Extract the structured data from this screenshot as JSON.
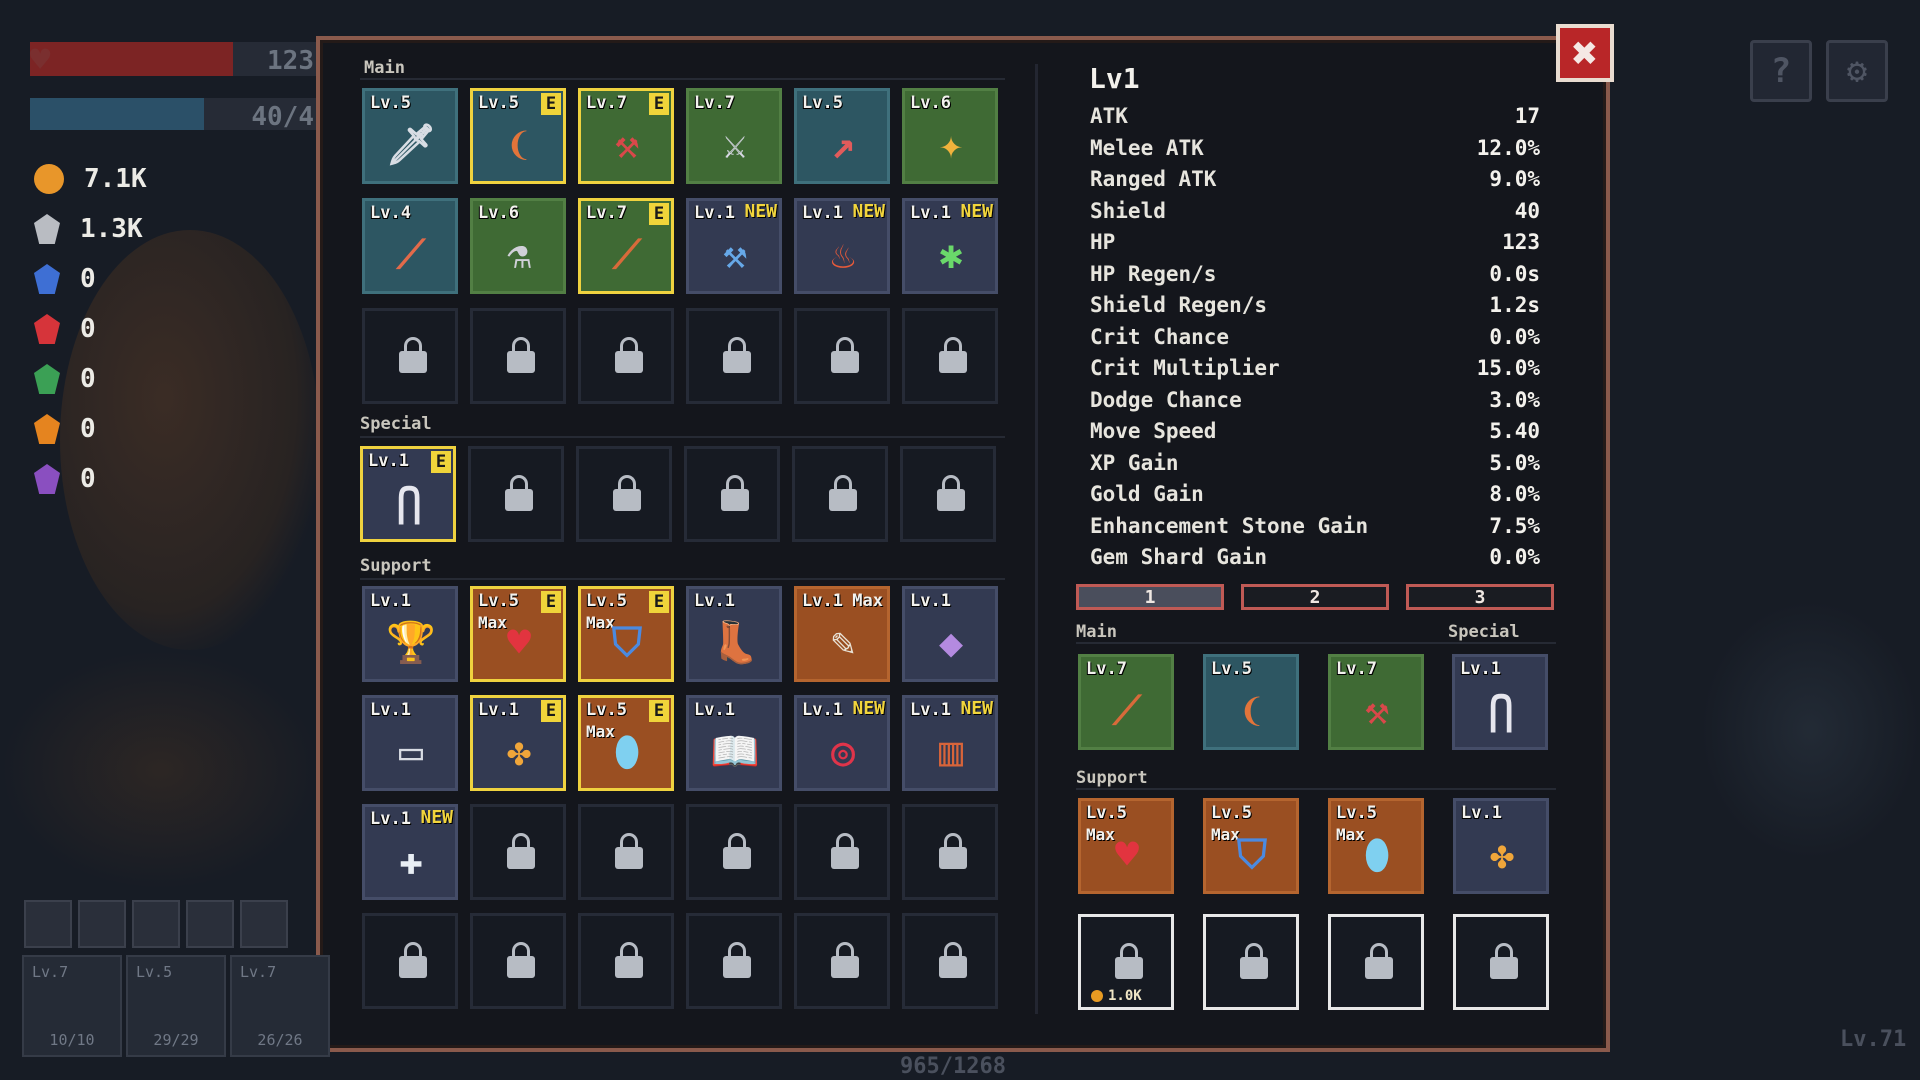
{
  "hud": {
    "hp_text": "123",
    "xp_text": "40/4",
    "hp_fraction": 0.7,
    "xp_fraction": 0.6,
    "resources": [
      {
        "icon": "gold-coin-icon",
        "color": "#e8962a",
        "value": "7.1K"
      },
      {
        "icon": "silver-stone-icon",
        "color": "#b9bcc2",
        "value": "1.3K"
      },
      {
        "icon": "blue-gem-icon",
        "color": "#3e6fd4",
        "value": "0"
      },
      {
        "icon": "red-gem-icon",
        "color": "#d6343a",
        "value": "0"
      },
      {
        "icon": "green-gem-icon",
        "color": "#3ba055",
        "value": "0"
      },
      {
        "icon": "orange-gem-icon",
        "color": "#e5841f",
        "value": "0"
      },
      {
        "icon": "purple-gem-icon",
        "color": "#8a4fc0",
        "value": "0"
      }
    ],
    "help_label": "?",
    "exp_counter": "965/1268",
    "player_level": "Lv.71",
    "weapons": [
      {
        "level": "Lv.7",
        "count": "10/10"
      },
      {
        "level": "Lv.5",
        "count": "29/29"
      },
      {
        "level": "Lv.7",
        "count": "26/26"
      }
    ]
  },
  "close_label": "✖",
  "sections": {
    "main": "Main",
    "special": "Special",
    "support": "Support"
  },
  "inventory": {
    "main": [
      {
        "level": "Lv.5",
        "color": "teal",
        "icon": "sword-icon",
        "glyph": "🗡",
        "equipped": false,
        "badge": ""
      },
      {
        "level": "Lv.5",
        "color": "teal",
        "icon": "boomerang-icon",
        "glyph": "❨",
        "equipped": true,
        "badge": "E"
      },
      {
        "level": "Lv.7",
        "color": "green",
        "icon": "axe-icon",
        "glyph": "⚒",
        "equipped": true,
        "badge": "E"
      },
      {
        "level": "Lv.7",
        "color": "green",
        "icon": "gauntlet-sword-icon",
        "glyph": "⚔",
        "equipped": false,
        "badge": ""
      },
      {
        "level": "Lv.5",
        "color": "teal",
        "icon": "spear-icon",
        "glyph": "↗",
        "equipped": false,
        "badge": ""
      },
      {
        "level": "Lv.6",
        "color": "green",
        "icon": "magic-staff-icon",
        "glyph": "✦",
        "equipped": false,
        "badge": ""
      },
      {
        "level": "Lv.4",
        "color": "teal",
        "icon": "dagger-icon",
        "glyph": "⟋",
        "equipped": false,
        "badge": ""
      },
      {
        "level": "Lv.6",
        "color": "green",
        "icon": "potion-flask-icon",
        "glyph": "⚗",
        "equipped": false,
        "badge": ""
      },
      {
        "level": "Lv.7",
        "color": "green",
        "icon": "wand-icon",
        "glyph": "⟋",
        "equipped": true,
        "badge": "E"
      },
      {
        "level": "Lv.1",
        "color": "blue",
        "icon": "hammer-icon",
        "glyph": "⚒",
        "equipped": false,
        "badge": "NEW"
      },
      {
        "level": "Lv.1",
        "color": "blue",
        "icon": "torch-icon",
        "glyph": "♨",
        "equipped": false,
        "badge": "NEW"
      },
      {
        "level": "Lv.1",
        "color": "blue",
        "icon": "trident-icon",
        "glyph": "✱",
        "equipped": false,
        "badge": "NEW"
      },
      {
        "locked": true
      },
      {
        "locked": true
      },
      {
        "locked": true
      },
      {
        "locked": true
      },
      {
        "locked": true
      },
      {
        "locked": true
      }
    ],
    "special": [
      {
        "level": "Lv.1",
        "color": "blue",
        "icon": "arch-gate-icon",
        "glyph": "⋂",
        "equipped": true,
        "badge": "E"
      },
      {
        "locked": true
      },
      {
        "locked": true
      },
      {
        "locked": true
      },
      {
        "locked": true
      },
      {
        "locked": true
      }
    ],
    "support": [
      {
        "level": "Lv.1",
        "color": "blue",
        "icon": "trophy-icon",
        "glyph": "🏆",
        "equipped": false,
        "badge": ""
      },
      {
        "level": "Lv.5",
        "max": "Max",
        "color": "orange",
        "icon": "heart-icon",
        "glyph": "♥",
        "equipped": true,
        "badge": "E"
      },
      {
        "level": "Lv.5",
        "max": "Max",
        "color": "orange",
        "icon": "shield-icon",
        "glyph": "⛉",
        "equipped": true,
        "badge": "E"
      },
      {
        "level": "Lv.1",
        "color": "blue",
        "icon": "boot-icon",
        "glyph": "👢",
        "equipped": false,
        "badge": ""
      },
      {
        "level": "Lv.1",
        "maxright": "Max",
        "color": "orange",
        "icon": "feather-icon",
        "glyph": "✎",
        "equipped": false,
        "badge": ""
      },
      {
        "level": "Lv.1",
        "color": "blue",
        "icon": "crystal-orb-icon",
        "glyph": "◆",
        "equipped": false,
        "badge": ""
      },
      {
        "level": "Lv.1",
        "color": "blue",
        "icon": "scroll-icon",
        "glyph": "▭",
        "equipped": false,
        "badge": ""
      },
      {
        "level": "Lv.1",
        "color": "blue",
        "icon": "clover-icon",
        "glyph": "✤",
        "equipped": true,
        "badge": "E"
      },
      {
        "level": "Lv.5",
        "max": "Max",
        "color": "orange",
        "icon": "crystal-shard-icon",
        "glyph": "⬮",
        "equipped": true,
        "badge": "E"
      },
      {
        "level": "Lv.1",
        "color": "blue",
        "icon": "book-icon",
        "glyph": "📖",
        "equipped": false,
        "badge": ""
      },
      {
        "level": "Lv.1",
        "color": "blue",
        "icon": "ring-icon",
        "glyph": "◎",
        "equipped": false,
        "badge": "NEW"
      },
      {
        "level": "Lv.1",
        "color": "blue",
        "icon": "barrel-icon",
        "glyph": "▥",
        "equipped": false,
        "badge": "NEW"
      },
      {
        "level": "Lv.1",
        "color": "blue",
        "icon": "cross-icon",
        "glyph": "✚",
        "equipped": false,
        "badge": "NEW"
      },
      {
        "locked": true
      },
      {
        "locked": true
      },
      {
        "locked": true
      },
      {
        "locked": true
      },
      {
        "locked": true
      },
      {
        "locked": true
      },
      {
        "locked": true
      },
      {
        "locked": true
      },
      {
        "locked": true
      },
      {
        "locked": true
      },
      {
        "locked": true
      }
    ]
  },
  "stats": {
    "title": "Lv1",
    "rows": [
      {
        "name": "ATK",
        "value": "17"
      },
      {
        "name": "Melee ATK",
        "value": "12.0%"
      },
      {
        "name": "Ranged ATK",
        "value": "9.0%"
      },
      {
        "name": "Shield",
        "value": "40"
      },
      {
        "name": "HP",
        "value": "123"
      },
      {
        "name": "HP Regen/s",
        "value": "0.0s"
      },
      {
        "name": "Shield Regen/s",
        "value": "1.2s"
      },
      {
        "name": "Crit Chance",
        "value": "0.0%"
      },
      {
        "name": "Crit Multiplier",
        "value": "15.0%"
      },
      {
        "name": "Dodge Chance",
        "value": "3.0%"
      },
      {
        "name": "Move Speed",
        "value": "5.40"
      },
      {
        "name": "XP Gain",
        "value": "5.0%"
      },
      {
        "name": "Gold Gain",
        "value": "8.0%"
      },
      {
        "name": "Enhancement Stone Gain",
        "value": "7.5%"
      },
      {
        "name": "Gem Shard Gain",
        "value": "0.0%"
      }
    ]
  },
  "loadout": {
    "tabs": [
      "1",
      "2",
      "3"
    ],
    "active_tab": 0,
    "main_label": "Main",
    "special_label": "Special",
    "support_label": "Support",
    "main": [
      {
        "level": "Lv.7",
        "color": "green",
        "icon": "wand-icon",
        "glyph": "⟋"
      },
      {
        "level": "Lv.5",
        "color": "teal",
        "icon": "boomerang-icon",
        "glyph": "❨"
      },
      {
        "level": "Lv.7",
        "color": "green",
        "icon": "axe-icon",
        "glyph": "⚒"
      }
    ],
    "special": [
      {
        "level": "Lv.1",
        "color": "blue",
        "icon": "arch-gate-icon",
        "glyph": "⋂"
      }
    ],
    "support": [
      {
        "level": "Lv.5",
        "max": "Max",
        "color": "orange",
        "icon": "heart-icon",
        "glyph": "♥"
      },
      {
        "level": "Lv.5",
        "max": "Max",
        "color": "orange",
        "icon": "shield-icon",
        "glyph": "⛉"
      },
      {
        "level": "Lv.5",
        "max": "Max",
        "color": "orange",
        "icon": "crystal-shard-icon",
        "glyph": "⬮"
      },
      {
        "level": "Lv.1",
        "color": "blue",
        "icon": "clover-icon",
        "glyph": "✤"
      }
    ],
    "locked_slots": [
      {
        "cost": "1.0K"
      },
      {
        "cost": ""
      },
      {
        "cost": ""
      },
      {
        "cost": ""
      }
    ]
  },
  "glyph_colors": {
    "sword-icon": "#d8dde4",
    "boomerang-icon": "#e2743a",
    "axe-icon": "#d9484a",
    "gauntlet-sword-icon": "#d9d9e6",
    "spear-icon": "#e25b5b",
    "magic-staff-icon": "#f0b23c",
    "dagger-icon": "#e26a4a",
    "potion-flask-icon": "#d0d0d8",
    "wand-icon": "#d86a3a",
    "hammer-icon": "#66a8e8",
    "torch-icon": "#e65a3a",
    "trident-icon": "#6ad86a",
    "arch-gate-icon": "#e6e6ee",
    "trophy-icon": "#f0b93a",
    "heart-icon": "#e2343f",
    "shield-icon": "#4b8ae0",
    "boot-icon": "#b8bcc6",
    "feather-icon": "#e8e2d6",
    "crystal-orb-icon": "#b48ae0",
    "scroll-icon": "#d8dce4",
    "clover-icon": "#f0a63a",
    "crystal-shard-icon": "#7fd0f0",
    "book-icon": "#e08a4a",
    "ring-icon": "#e0344a",
    "barrel-icon": "#d8643a",
    "cross-icon": "#e8eef4"
  }
}
